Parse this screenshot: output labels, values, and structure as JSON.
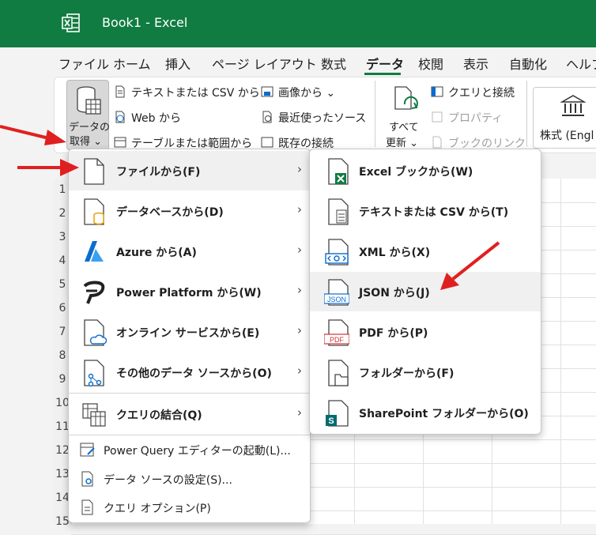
{
  "app": {
    "title": "Book1  -  Excel"
  },
  "ribbon_tabs": [
    "ファイル",
    "ホーム",
    "挿入",
    "ページ レイアウト",
    "数式",
    "データ",
    "校閲",
    "表示",
    "自動化",
    "ヘルプ"
  ],
  "active_tab": "データ",
  "ribbon": {
    "get_data_line1": "データの",
    "get_data_line2": "取得 ⌄",
    "text_csv": "テキストまたは CSV から",
    "web": "Web から",
    "table_range": "テーブルまたは範囲から",
    "image": "画像から ⌄",
    "recent": "最近使ったソース",
    "existing": "既存の接続",
    "refresh_line1": "すべて",
    "refresh_line2": "更新 ⌄",
    "queries": "クエリと接続",
    "properties": "プロパティ",
    "workbook_links": "ブックのリンク",
    "stocks": "株式 (Engl"
  },
  "row_numbers": [
    "1",
    "2",
    "3",
    "4",
    "5",
    "6",
    "7",
    "8",
    "9",
    "10",
    "11",
    "12",
    "13",
    "14",
    "15"
  ],
  "menu_main": {
    "items": [
      {
        "label": "ファイルから(F)",
        "icon": "file-icon"
      },
      {
        "label": "データベースから(D)",
        "icon": "database-icon"
      },
      {
        "label": "Azure から(A)",
        "icon": "azure-icon"
      },
      {
        "label": "Power Platform から(W)",
        "icon": "power-platform-icon"
      },
      {
        "label": "オンライン サービスから(E)",
        "icon": "cloud-file-icon"
      },
      {
        "label": "その他のデータ ソースから(O)",
        "icon": "other-source-icon"
      },
      {
        "label": "クエリの結合(Q)",
        "icon": "combine-queries-icon"
      }
    ],
    "small_items": [
      {
        "label": "Power Query エディターの起動(L)..."
      },
      {
        "label": "データ ソースの設定(S)..."
      },
      {
        "label": "クエリ オプション(P)"
      }
    ]
  },
  "menu_file": {
    "items": [
      {
        "label": "Excel ブックから(W)",
        "icon": "excel-file-icon"
      },
      {
        "label": "テキストまたは CSV から(T)",
        "icon": "text-file-icon"
      },
      {
        "label": "XML から(X)",
        "icon": "xml-file-icon"
      },
      {
        "label": "JSON から(J)",
        "icon": "json-file-icon",
        "icon_text": "JSON"
      },
      {
        "label": "PDF から(P)",
        "icon": "pdf-file-icon",
        "icon_text": "PDF"
      },
      {
        "label": "フォルダーから(F)",
        "icon": "folder-icon"
      },
      {
        "label": "SharePoint フォルダーから(O)",
        "icon": "sharepoint-icon",
        "icon_text": "S"
      }
    ]
  },
  "colors": {
    "excel_green": "#107c41",
    "arrow_red": "#e02020",
    "azure_blue": "#0a6ccf"
  }
}
